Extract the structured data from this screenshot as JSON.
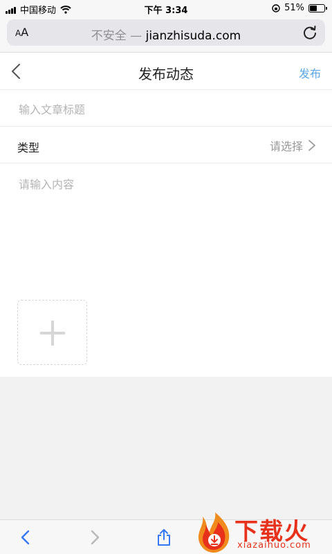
{
  "status_bar": {
    "carrier": "中国移动",
    "time": "下午 3:34",
    "battery": "51%",
    "battery_level": 0.51
  },
  "browser": {
    "text_size": "AA",
    "insecure_label": "不安全 —",
    "domain": "jianzhisuda.com"
  },
  "header": {
    "title": "发布动态",
    "publish_label": "发布"
  },
  "form": {
    "title_placeholder": "输入文章标题",
    "type_label": "类型",
    "type_value": "请选择",
    "content_placeholder": "请输入内容"
  },
  "watermark": {
    "brand": "下载火",
    "domain": "xiazaihuo.com"
  },
  "colors": {
    "accent": "#5aa9e6",
    "placeholder": "#b4b4b4",
    "watermark": "#e8311a"
  }
}
